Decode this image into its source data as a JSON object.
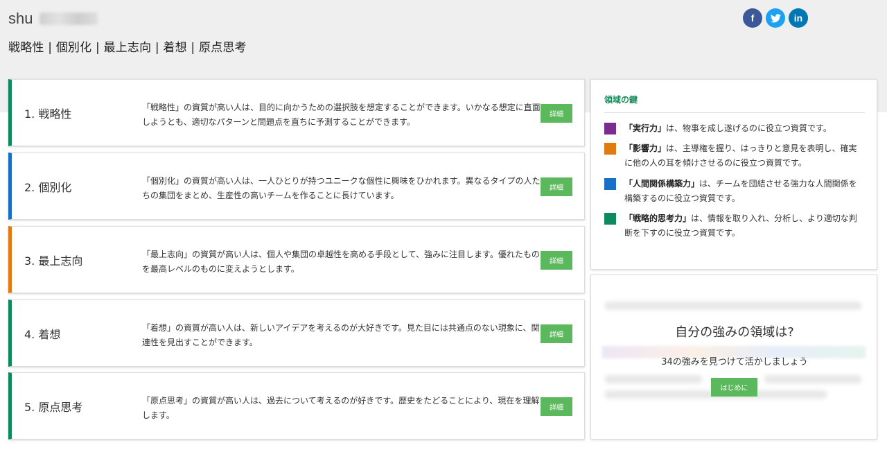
{
  "profile": {
    "name": "shu",
    "themes_line": "戦略性 | 個別化 | 最上志向 | 着想 | 原点思考"
  },
  "social": {
    "facebook": {
      "icon": "facebook-icon",
      "glyph": "f"
    },
    "twitter": {
      "icon": "twitter-icon",
      "glyph": "🐦"
    },
    "linkedin": {
      "icon": "linkedin-icon",
      "glyph": "in"
    }
  },
  "strengths": [
    {
      "rank": "1. 戦略性",
      "domain_color": "#0f8a5f",
      "description": "「戦略性」の資質が高い人は、目的に向かうための選択肢を想定することができます。いかなる想定に直面しようとも、適切なパターンと問題点を直ちに予測することができます。",
      "detail_label": "詳細"
    },
    {
      "rank": "2. 個別化",
      "domain_color": "#1a6fc4",
      "description": "「個別化」の資質が高い人は、一人ひとりが持つユニークな個性に興味をひかれます。異なるタイプの人たちの集団をまとめ、生産性の高いチームを作ることに長けています。",
      "detail_label": "詳細"
    },
    {
      "rank": "3. 最上志向",
      "domain_color": "#e07b11",
      "description": "「最上志向」の資質が高い人は、個人や集団の卓越性を高める手段として、強みに注目します。優れたものを最高レベルのものに変えようとします。",
      "detail_label": "詳細"
    },
    {
      "rank": "4. 着想",
      "domain_color": "#0f8a5f",
      "description": "「着想」の資質が高い人は、新しいアイデアを考えるのが大好きです。見た目には共通点のない現象に、関連性を見出すことができます。",
      "detail_label": "詳細"
    },
    {
      "rank": "5. 原点思考",
      "domain_color": "#0f8a5f",
      "description": "「原点思考」の資質が高い人は、過去について考えるのが好きです。歴史をたどることにより、現在を理解します。",
      "detail_label": "詳細"
    }
  ],
  "domain_key": {
    "heading": "領域の鍵",
    "items": [
      {
        "name": "「実行力」",
        "text": "は、物事を成し遂げるのに役立つ資質です。",
        "color": "#7b2d8e"
      },
      {
        "name": "「影響力」",
        "text": "は、主導権を握り、はっきりと意見を表明し、確実に他の人の耳を傾けさせるのに役立つ資質です。",
        "color": "#e07b11"
      },
      {
        "name": "「人間関係構築力」",
        "text": "は、チームを団結させる強力な人間関係を構築するのに役立つ資質です。",
        "color": "#1a6fc4"
      },
      {
        "name": "「戦略的思考力」",
        "text": "は、情報を取り入れ、分析し、より適切な判断を下すのに役立つ資質です。",
        "color": "#0f8a5f"
      }
    ]
  },
  "cta": {
    "title": "自分の強みの領域は?",
    "subtitle": "34の強みを見つけて活かしましょう",
    "button_label": "はじめに"
  }
}
